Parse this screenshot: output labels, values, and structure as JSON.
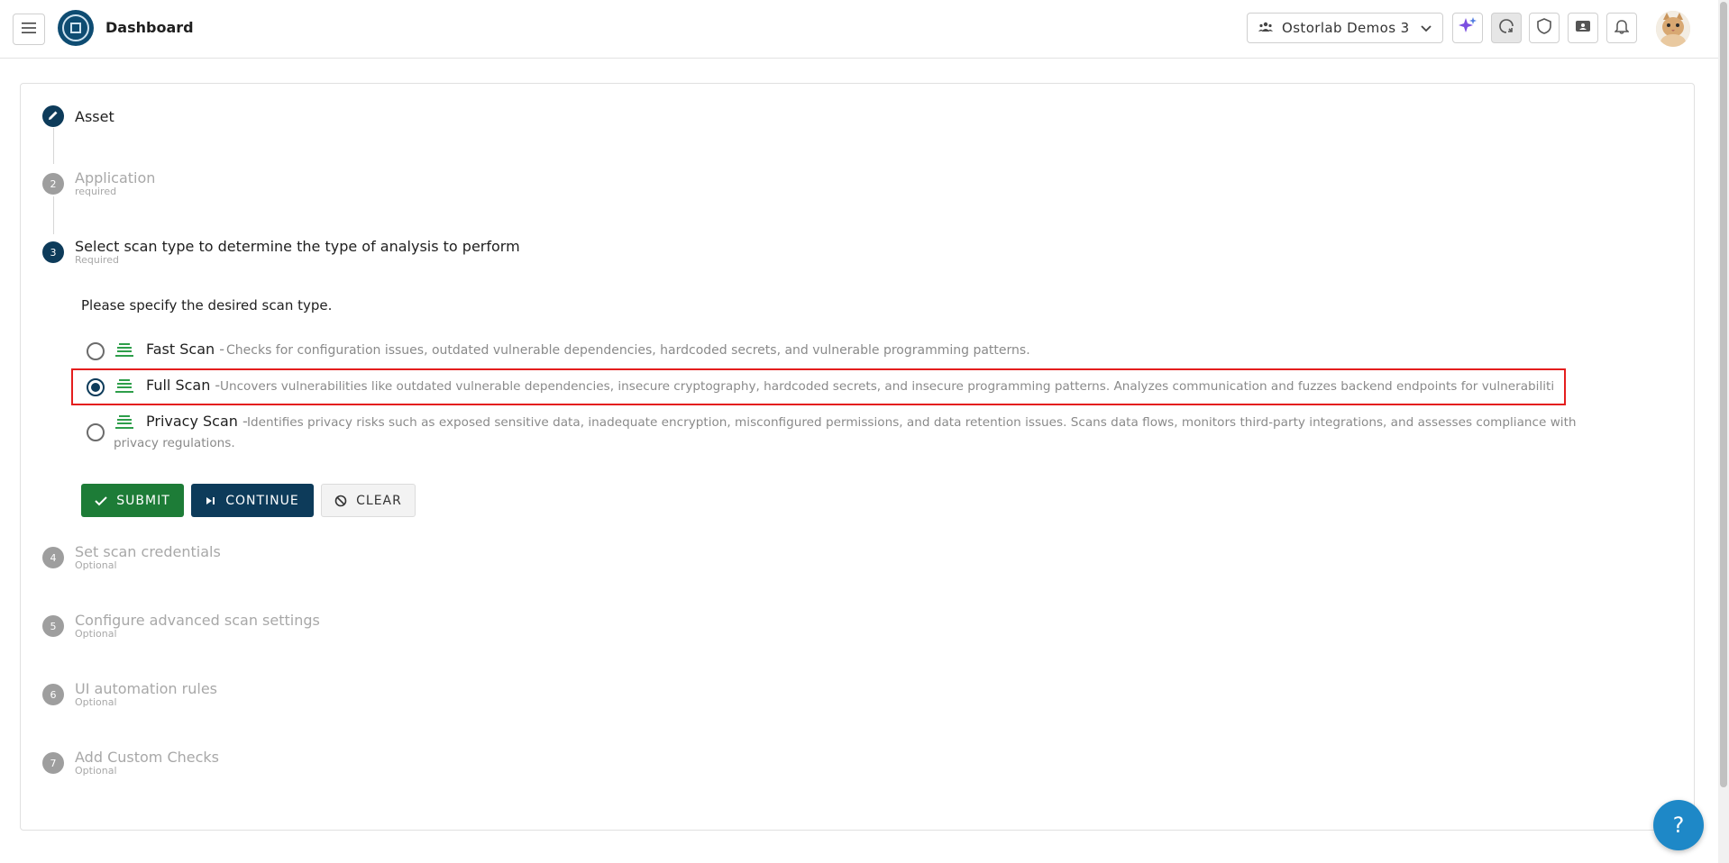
{
  "header": {
    "title": "Dashboard",
    "organization": "Ostorlab Demos 3"
  },
  "stepper": {
    "steps": [
      {
        "number": "",
        "title": "Asset",
        "subtitle": "",
        "state": "done"
      },
      {
        "number": "2",
        "title": "Application",
        "subtitle": "required",
        "state": "todo"
      },
      {
        "number": "3",
        "title": "Select scan type to determine the type of analysis to perform",
        "subtitle": "Required",
        "state": "active"
      },
      {
        "number": "4",
        "title": "Set scan credentials",
        "subtitle": "Optional",
        "state": "todo"
      },
      {
        "number": "5",
        "title": "Configure advanced scan settings",
        "subtitle": "Optional",
        "state": "todo"
      },
      {
        "number": "6",
        "title": "UI automation rules",
        "subtitle": "Optional",
        "state": "todo"
      },
      {
        "number": "7",
        "title": "Add Custom Checks",
        "subtitle": "Optional",
        "state": "todo"
      }
    ]
  },
  "scan_type": {
    "prompt": "Please specify the desired scan type.",
    "options": [
      {
        "name": "Fast Scan",
        "separator": " -",
        "description": "Checks for configuration issues, outdated vulnerable dependencies, hardcoded secrets, and vulnerable programming patterns.",
        "selected": false
      },
      {
        "name": "Full Scan",
        "separator": " -",
        "description": "Uncovers vulnerabilities like outdated vulnerable dependencies, insecure cryptography, hardcoded secrets, and insecure programming patterns. Analyzes communication and fuzzes backend endpoints for vulnerabilities.",
        "selected": true
      },
      {
        "name": "Privacy Scan",
        "separator": " -",
        "description": "Identifies privacy risks such as exposed sensitive data, inadequate encryption, misconfigured permissions, and data retention issues. Scans data flows, monitors third-party integrations, and assesses compliance with privacy regulations.",
        "selected": false
      }
    ]
  },
  "actions": {
    "submit": "SUBMIT",
    "continue": "CONTINUE",
    "clear": "CLEAR"
  },
  "help": {
    "label": "?"
  },
  "colors": {
    "primary": "#0d3b5a",
    "success": "#1d7c37",
    "highlight": "#e41e1e",
    "fab": "#1e88c7"
  }
}
